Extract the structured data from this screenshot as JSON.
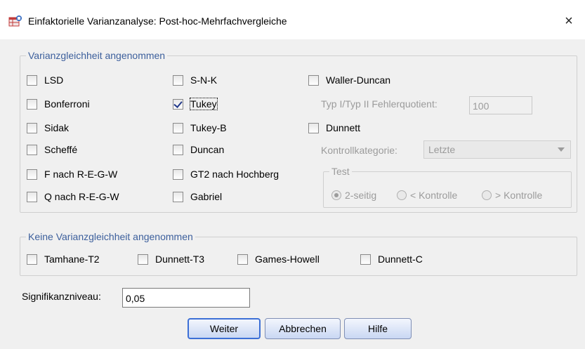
{
  "window": {
    "title": "Einfaktorielle Varianzanalyse: Post-hoc-Mehrfachvergleiche",
    "close_label": "×"
  },
  "equal_variances": {
    "legend": "Varianzgleichheit angenommen",
    "col1": [
      "LSD",
      "Bonferroni",
      "Sidak",
      "Scheffé",
      "F nach R-E-G-W",
      "Q nach R-E-G-W"
    ],
    "col2": [
      "S-N-K",
      "Tukey",
      "Tukey-B",
      "Duncan",
      "GT2 nach Hochberg",
      "Gabriel"
    ],
    "checked": [
      "Tukey"
    ],
    "waller_duncan": "Waller-Duncan",
    "error_ratio_label": "Typ I/Typ II Fehlerquotient:",
    "error_ratio_value": "100",
    "dunnett": "Dunnett",
    "control_category_label": "Kontrollkategorie:",
    "control_category_value": "Letzte",
    "test_legend": "Test",
    "test_options": [
      "2-seitig",
      "< Kontrolle",
      "> Kontrolle"
    ],
    "test_selected": "2-seitig"
  },
  "unequal_variances": {
    "legend": "Keine Varianzgleichheit angenommen",
    "options": [
      "Tamhane-T2",
      "Dunnett-T3",
      "Games-Howell",
      "Dunnett-C"
    ]
  },
  "significance": {
    "label": "Signifikanzniveau:",
    "value": "0,05"
  },
  "buttons": {
    "continue": "Weiter",
    "cancel": "Abbrechen",
    "help": "Hilfe"
  },
  "colors": {
    "legend": "#3c5f9c",
    "check": "#233a8a",
    "default_button_border": "#3c6fd6"
  }
}
